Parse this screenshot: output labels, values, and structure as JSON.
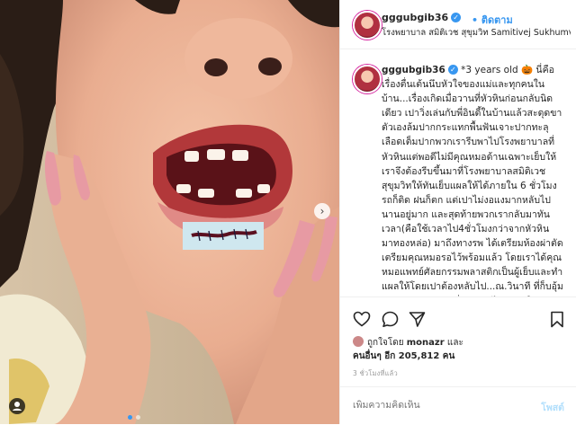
{
  "post": {
    "username": "gggubgib36",
    "follow_label": "ติดตาม",
    "location": "โรงพยาบาล สมิติเวช สุขุมวิท Samitivej Sukhumvi..."
  },
  "caption": {
    "username": "gggubgib36",
    "text": "*3 years old 🎃 นี่คือเรื่องตื่นเต้นนึบหัวใจของแม่และทุกคนในบ้าน...เรื่องเกิดเมื่อวานที่หัวหินก่อนกลับนิดเดียว เปาวิ่งเล่นกับพี่อินดี้ในบ้านแล้วสะดุดขาตัวเองล้มปากกระแทกพื้นฟันเจาะปากทะลุเลือดเต็มปากพวกเรารีบพาไปโรงพยาบาลที่หัวหินแต่พอดีไม่มีคุณหมอด้านเฉพาะเย็บให้เราจึงต้องรีบขึ้นมาที่โรงพยาบาลสมิติเวชสุขุมวิทให้ทันเย็บแผลให้ได้ภายใน 6 ชั่วโมง รถก็ติด ฝนก็ตก แต่เปาไม่งอแงมากหลับไปนานอยู่มาก และสุดท้ายพวกเรากลับมาทันเวลา(คือใช้เวลาไป4ชั่วโมงกว่าจากหัวหินมาทองหล่อ) มาถึงทางรพ ได้เตรียมห้องผ่าตัดเตรียมคุณหมอรอไว้พร้อมแล้ว โดยเราได้คุณหมอแพทย์ศัลยกรรมพลาสติกเป็นผู้เย็บและทำแผลให้โดยเปาต้องหลับไป...ณ.วินาที ที่ก็บอุ้มเปาเข้าห้องผ่าตัดเพื่อพาเค้าไปฉีดยาให้หลับ ..."
  },
  "likes": {
    "liked_by_prefix": "ถูกใจโดย",
    "liked_by_user": "monazr",
    "and": "และ",
    "others_label": "คนอื่นๆ อีก",
    "others_count": "205,812",
    "unit": "คน"
  },
  "timestamp": "3 ชั่วโมงที่แล้ว",
  "comment": {
    "placeholder": "เพิ่มความคิดเห็น",
    "post_label": "โพสต์"
  },
  "carousel": {
    "count": 2,
    "active": 0
  },
  "colors": {
    "link": "#3897f0",
    "post_disabled": "#b2dffc",
    "text": "#262626",
    "muted": "#999999"
  }
}
